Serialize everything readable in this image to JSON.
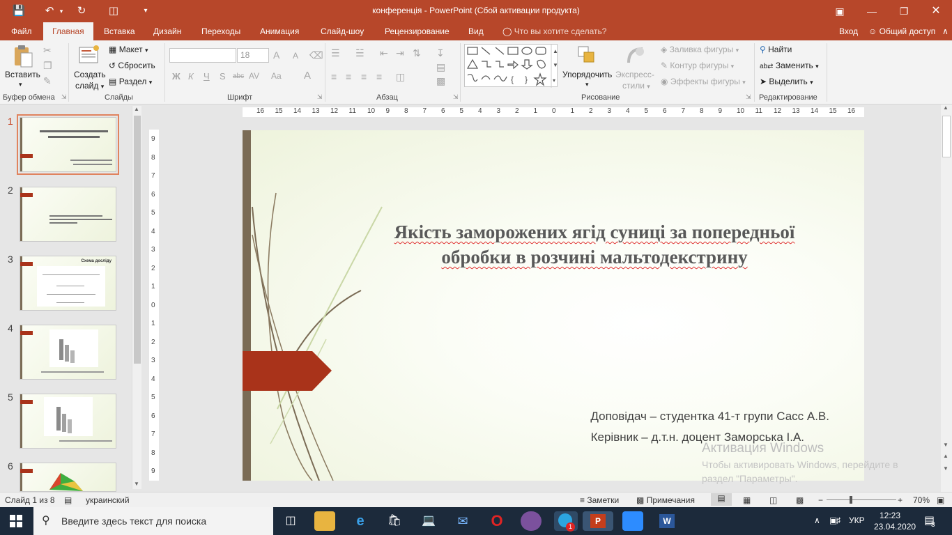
{
  "window": {
    "title": "конференція - PowerPoint (Сбой активации продукта)"
  },
  "tabs": [
    {
      "label": "Файл"
    },
    {
      "label": "Главная"
    },
    {
      "label": "Вставка"
    },
    {
      "label": "Дизайн"
    },
    {
      "label": "Переходы"
    },
    {
      "label": "Анимация"
    },
    {
      "label": "Слайд-шоу"
    },
    {
      "label": "Рецензирование"
    },
    {
      "label": "Вид"
    }
  ],
  "tell_me": "Что вы хотите сделать?",
  "signin": "Вход",
  "share": "Общий доступ",
  "ribbon": {
    "clipboard": {
      "paste": "Вставить",
      "label": "Буфер обмена"
    },
    "slides": {
      "new_slide_1": "Создать",
      "new_slide_2": "слайд",
      "layout": "Макет",
      "reset": "Сбросить",
      "section": "Раздел",
      "label": "Слайды"
    },
    "font": {
      "size": "18",
      "label": "Шрифт",
      "bold": "Ж",
      "italic": "К",
      "underline": "Ч",
      "shadow": "S",
      "strike": "abc",
      "spacing": "AV",
      "case": "Aa",
      "color": "A",
      "grow": "A",
      "shrink": "A"
    },
    "paragraph": {
      "label": "Абзац"
    },
    "drawing": {
      "arrange_1": "Упорядочить",
      "quick_1": "Экспресс-",
      "quick_2": "стили",
      "fill": "Заливка фигуры",
      "outline": "Контур фигуры",
      "effects": "Эффекты фигуры",
      "label": "Рисование"
    },
    "editing": {
      "find": "Найти",
      "replace": "Заменить",
      "select": "Выделить",
      "label": "Редактирование"
    }
  },
  "ruler": {
    "h_ticks": [
      "16",
      "15",
      "14",
      "13",
      "12",
      "11",
      "10",
      "9",
      "8",
      "7",
      "6",
      "5",
      "4",
      "3",
      "2",
      "1",
      "0",
      "1",
      "2",
      "3",
      "4",
      "5",
      "6",
      "7",
      "8",
      "9",
      "10",
      "11",
      "12",
      "13",
      "14",
      "15",
      "16"
    ],
    "v_ticks": [
      "9",
      "8",
      "7",
      "6",
      "5",
      "4",
      "3",
      "2",
      "1",
      "0",
      "1",
      "2",
      "3",
      "4",
      "5",
      "6",
      "7",
      "8",
      "9"
    ]
  },
  "thumbnails": [
    {
      "num": "1"
    },
    {
      "num": "2"
    },
    {
      "num": "3",
      "title": "Схема досліду"
    },
    {
      "num": "4"
    },
    {
      "num": "5"
    },
    {
      "num": "6"
    }
  ],
  "slide": {
    "title_line1": "Якість заморожених ягід суниці за попередньої",
    "title_line2": "обробки в розчині мальтодекстрину",
    "presenter": "Доповідач – студентка 41-т групи  Сасс А.В.",
    "supervisor": "Керівник – д.т.н. доцент Заморська І.А."
  },
  "watermark": {
    "line1": "Активация Windows",
    "line2": "Чтобы активировать Windows, перейдите в раздел \"Параметры\"."
  },
  "status": {
    "slide_of": "Слайд 1 из 8",
    "language": "украинский",
    "notes": "Заметки",
    "comments": "Примечания",
    "zoom": "70%",
    "zoom_level": 0.35
  },
  "taskbar": {
    "search_placeholder": "Введите здесь текст для поиска",
    "lang": "УКР",
    "time": "12:23",
    "date": "23.04.2020",
    "notif_count": "3",
    "telegram_badge": "1"
  },
  "colors": {
    "accent": "#b7472a",
    "flag": "#a9331a",
    "taskbar": "#1c2a3b"
  }
}
